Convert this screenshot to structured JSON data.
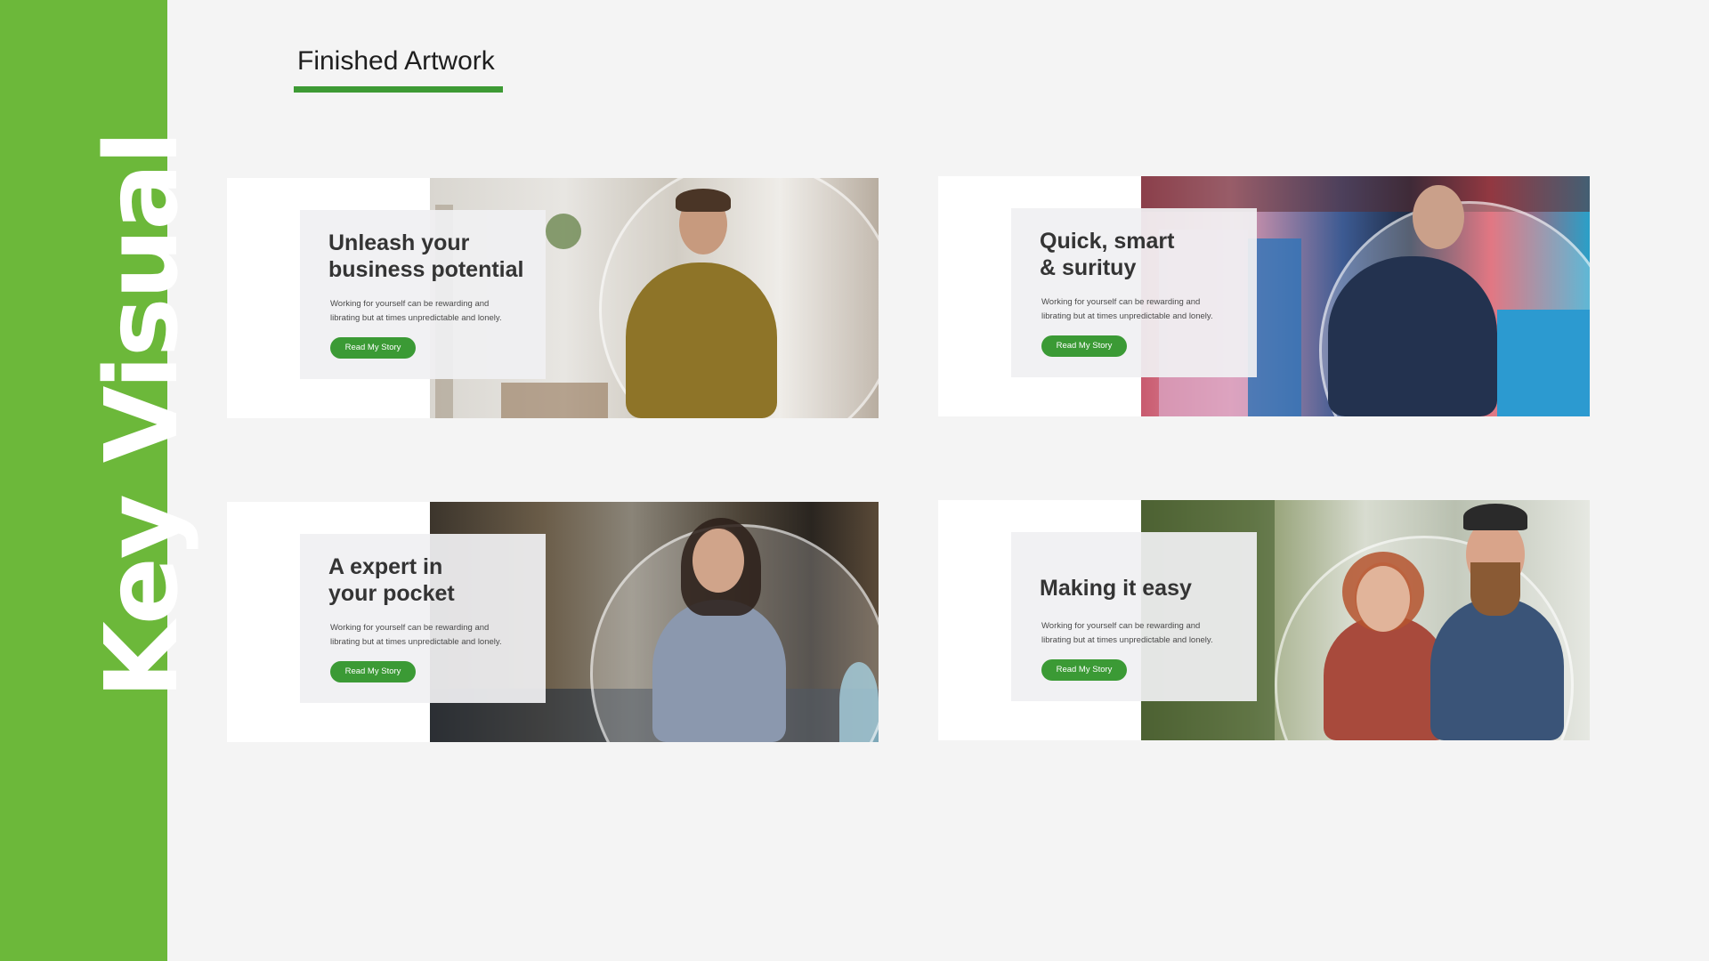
{
  "sidebar": {
    "title": "Key Visual",
    "color": "#6cb83a"
  },
  "page": {
    "heading": "Finished Artwork",
    "accent": "#3d9a34"
  },
  "banners": [
    {
      "title_line1": "Unleash your",
      "title_line2": "business potential",
      "text_line1": "Working for yourself can be rewarding and",
      "text_line2": "librating but at times unpredictable and lonely.",
      "button": "Read My Story",
      "photo": "woman in mustard shirt in boutique"
    },
    {
      "title_line1": "Quick, smart",
      "title_line2": "& surituy",
      "text_line1": "Working for yourself can be rewarding and",
      "text_line2": "librating but at times unpredictable and lonely.",
      "button": "Read My Story",
      "photo": "man with glasses at clothing rack"
    },
    {
      "title_line1": "A expert in",
      "title_line2": "your pocket",
      "text_line1": "Working for yourself can be rewarding and",
      "text_line2": "librating but at times unpredictable and lonely.",
      "button": "Read My Story",
      "photo": "woman in grey top in cafe"
    },
    {
      "title_line1": "Making it easy",
      "title_line2": "",
      "text_line1": "Working for yourself can be rewarding and",
      "text_line2": "librating but at times unpredictable and lonely.",
      "button": "Read My Story",
      "photo": "couple in aprons in garden cafe"
    }
  ]
}
